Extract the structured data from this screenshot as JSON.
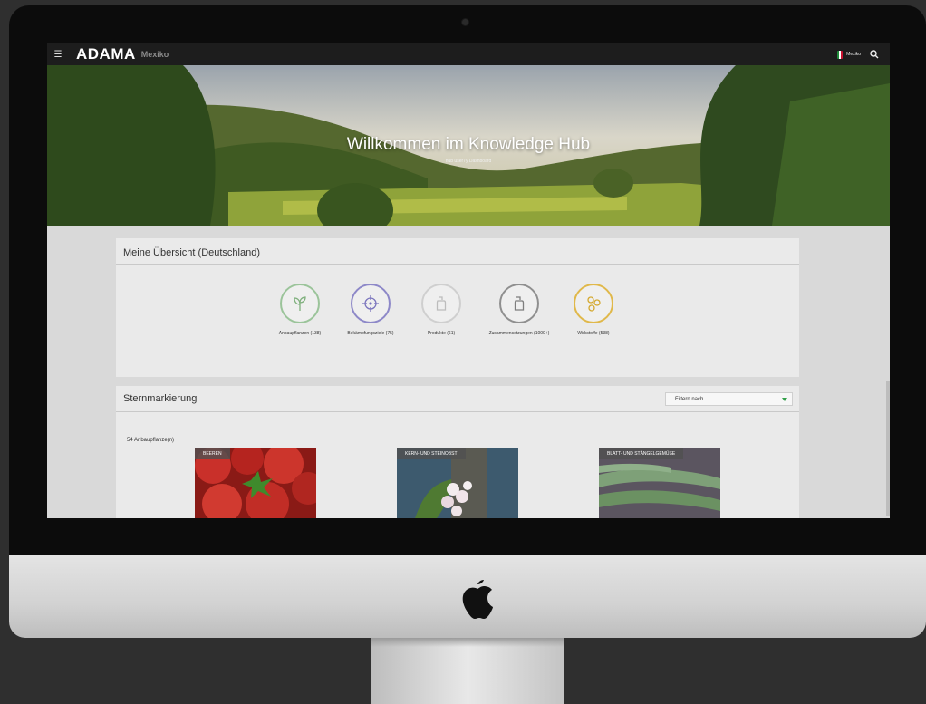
{
  "header": {
    "brand": "ADAMA",
    "region": "Mexiko",
    "country": "Mexiko"
  },
  "hero": {
    "title": "Willkommen im Knowledge Hub",
    "subtitle": "hub user7y Dashboard"
  },
  "overview": {
    "title": "Meine Übersicht (Deutschland)",
    "stats": [
      {
        "label": "Anbaupflanzen (138)",
        "icon": "sprout-icon",
        "color": "#9bc49a"
      },
      {
        "label": "Bekämpfungsziele (75)",
        "icon": "crosshair-icon",
        "color": "#8d88c8"
      },
      {
        "label": "Produkte (61)",
        "icon": "bottle-icon",
        "color": "#bdbdbd"
      },
      {
        "label": "Zusammensetzungen (1000+)",
        "icon": "bottle-icon",
        "color": "#8f8f8f"
      },
      {
        "label": "Wirkstoffe (538)",
        "icon": "molecule-icon",
        "color": "#e0b84a"
      }
    ]
  },
  "starred": {
    "title": "Sternmarkierung",
    "filter_label": "Filtern nach",
    "count_label": "54 Anbaupflanze(n)",
    "cards": [
      {
        "tag": "BEEREN",
        "image": "strawberries"
      },
      {
        "tag": "KERN- UND STEINOBST",
        "image": "apple-blossom"
      },
      {
        "tag": "BLATT- UND STÄNGELGEMÜSE",
        "image": "asparagus"
      }
    ]
  },
  "colors": {
    "topbar": "#1d1d1d",
    "accent": "#33a04a",
    "frame": "#0c0c0c"
  }
}
